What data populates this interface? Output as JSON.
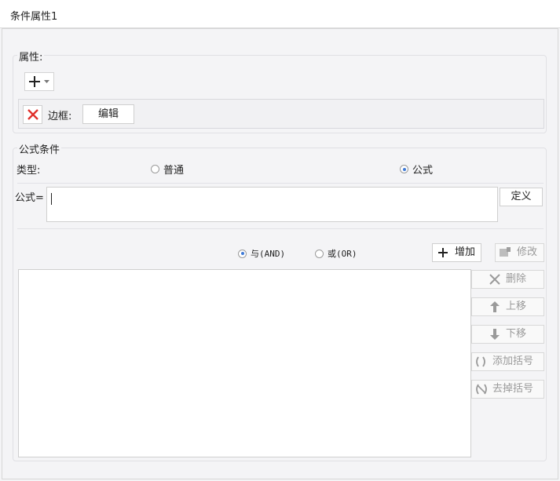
{
  "window": {
    "title": "条件属性1"
  },
  "properties": {
    "legend": "属性:",
    "add_icon": "plus-icon",
    "dropdown_icon": "caret-down-icon",
    "item": {
      "delete_icon": "red-x-icon",
      "label": "边框:",
      "edit_button": "编辑"
    }
  },
  "formula_section": {
    "legend": "公式条件",
    "type_label": "类型:",
    "radio_normal": "普通",
    "radio_formula": "公式",
    "selected_type": "公式",
    "formula_label": "公式=",
    "formula_value": "",
    "define_button": "定义",
    "and_label": "与(AND)",
    "or_label": "或(OR)",
    "selected_logic": "与(AND)",
    "buttons": {
      "add": "增加",
      "modify": "修改",
      "delete": "删除",
      "move_up": "上移",
      "move_down": "下移",
      "add_paren": "添加括号",
      "remove_paren": "去掉括号"
    }
  },
  "colors": {
    "accent": "#3f7ad6",
    "delete_red": "#e0302b"
  }
}
